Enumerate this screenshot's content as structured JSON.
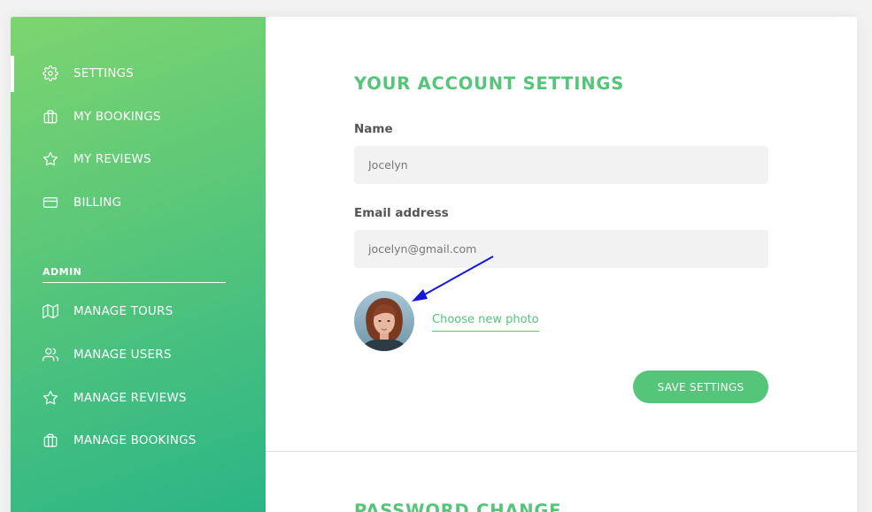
{
  "sidebar": {
    "items": [
      {
        "label": "SETTINGS",
        "icon": "gear-icon"
      },
      {
        "label": "MY BOOKINGS",
        "icon": "briefcase-icon"
      },
      {
        "label": "MY REVIEWS",
        "icon": "star-icon"
      },
      {
        "label": "BILLING",
        "icon": "credit-card-icon"
      }
    ],
    "admin_heading": "ADMIN",
    "admin_items": [
      {
        "label": "MANAGE TOURS",
        "icon": "map-icon"
      },
      {
        "label": "MANAGE USERS",
        "icon": "users-icon"
      },
      {
        "label": "MANAGE REVIEWS",
        "icon": "star-icon"
      },
      {
        "label": "MANAGE BOOKINGS",
        "icon": "briefcase-icon"
      }
    ]
  },
  "settings": {
    "title": "YOUR ACCOUNT SETTINGS",
    "name_label": "Name",
    "name_value": "Jocelyn",
    "email_label": "Email address",
    "email_value": "jocelyn@gmail.com",
    "photo_link": "Choose new photo",
    "save_button": "SAVE SETTINGS"
  },
  "password": {
    "title": "PASSWORD CHANGE"
  },
  "colors": {
    "accent": "#55c57a",
    "gradient_start": "#7dd56f",
    "gradient_end": "#28b487",
    "annotation_arrow": "#1515e0"
  }
}
